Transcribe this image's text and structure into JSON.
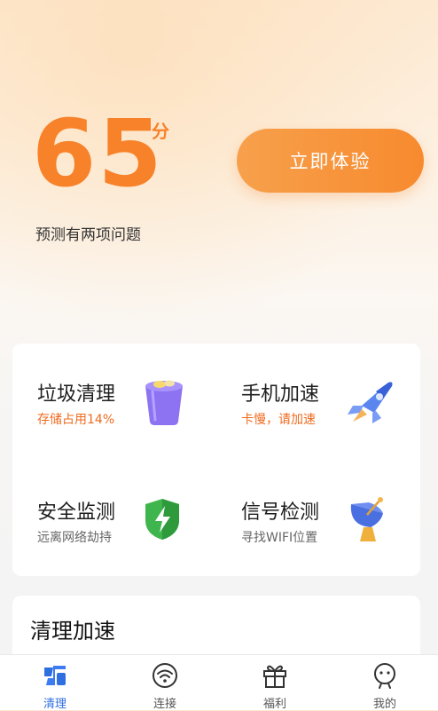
{
  "score": {
    "value": "65",
    "unit": "分",
    "description": "预测有两项问题"
  },
  "cta": {
    "label": "立即体验"
  },
  "features": [
    {
      "title": "垃圾清理",
      "subtitle": "存储占用14%",
      "icon": "trash-bin-icon"
    },
    {
      "title": "手机加速",
      "subtitle": "卡慢，请加速",
      "icon": "rocket-icon"
    },
    {
      "title": "安全监测",
      "subtitle": "远离网络劫持",
      "icon": "shield-bolt-icon"
    },
    {
      "title": "信号检测",
      "subtitle": "寻找WIFI位置",
      "icon": "satellite-dish-icon"
    }
  ],
  "section": {
    "title": "清理加速"
  },
  "tabs": [
    {
      "label": "清理",
      "icon": "clean-icon",
      "active": true
    },
    {
      "label": "连接",
      "icon": "wifi-icon",
      "active": false
    },
    {
      "label": "福利",
      "icon": "gift-icon",
      "active": false
    },
    {
      "label": "我的",
      "icon": "profile-icon",
      "active": false
    }
  ],
  "colors": {
    "accent": "#f7822a",
    "tab_active": "#2f6fe0",
    "subtitle_orange": "#ef6a1e"
  }
}
